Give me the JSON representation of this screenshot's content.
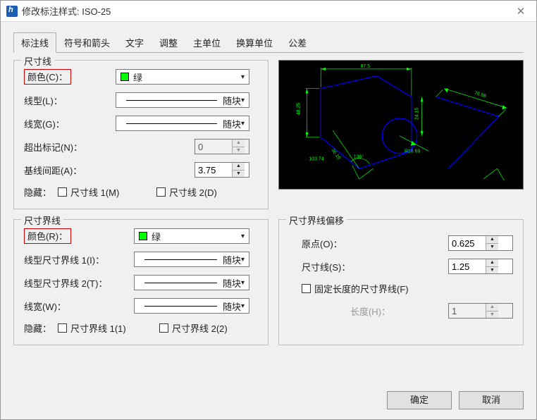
{
  "window": {
    "title": "修改标注样式: ISO-25"
  },
  "tabs": {
    "dimline": "标注线",
    "symbols": "符号和箭头",
    "text": "文字",
    "adjust": "调整",
    "primary": "主单位",
    "alt": "换算单位",
    "tolerance": "公差"
  },
  "dimline_group": {
    "title": "尺寸线",
    "color_label": "颜色(C)：",
    "color_value": "绿",
    "linetype_label": "线型(L)：",
    "linetype_value": "随块",
    "lineweight_label": "线宽(G)：",
    "lineweight_value": "随块",
    "extend_label": "超出标记(N)：",
    "extend_value": "0",
    "baseline_label": "基线间距(A)：",
    "baseline_value": "3.75",
    "hide_label": "隐藏：",
    "hide1": "尺寸线 1(M)",
    "hide2": "尺寸线 2(D)"
  },
  "extline_group": {
    "title": "尺寸界线",
    "color_label": "颜色(R)：",
    "color_value": "绿",
    "lt1_label": "线型尺寸界线 1(I)：",
    "lt1_value": "随块",
    "lt2_label": "线型尺寸界线 2(T)：",
    "lt2_value": "随块",
    "lw_label": "线宽(W)：",
    "lw_value": "随块",
    "hide_label": "隐藏：",
    "hide1": "尺寸界线 1(1)",
    "hide2": "尺寸界线 2(2)"
  },
  "offset_group": {
    "title": "尺寸界线偏移",
    "origin_label": "原点(O)：",
    "origin_value": "0.625",
    "dimline_label": "尺寸线(S)：",
    "dimline_value": "1.25",
    "fixed_label": "固定长度的尺寸界线(F)",
    "length_label": "长度(H)：",
    "length_value": "1"
  },
  "preview_dims": {
    "top": "87.5",
    "left": "48.25",
    "mid_v": "24.15",
    "diag": "36.10",
    "angle": "136°",
    "radius": "R18.69",
    "right": "76.98",
    "bl": "103.74"
  },
  "buttons": {
    "ok": "确定",
    "cancel": "取消"
  },
  "colors": {
    "green_swatch": "#00ff00"
  }
}
